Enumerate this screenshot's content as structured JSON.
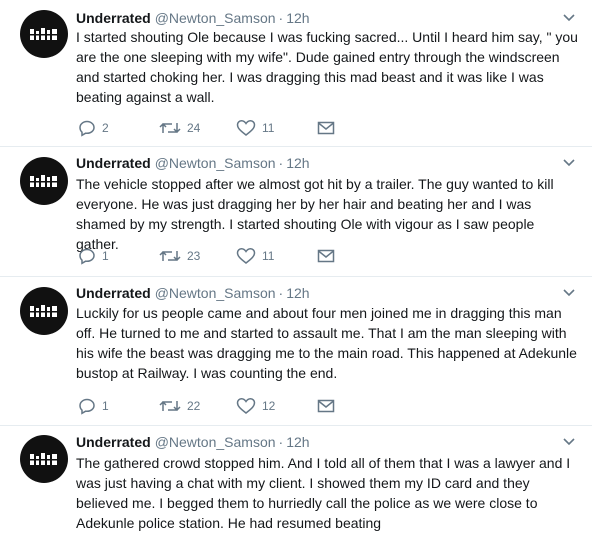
{
  "tweets": [
    {
      "name": "Underrated",
      "handle": "@Newton_Samson",
      "time": "12h",
      "text": "I started shouting Ole because I was fucking sacred... Until I heard him say, \" you are the one sleeping with my wife\". Dude gained entry through the windscreen and started choking her. I was dragging this mad beast and it was like I was beating against a wall.",
      "replies": "2",
      "retweets": "24",
      "likes": "11"
    },
    {
      "name": "Underrated",
      "handle": "@Newton_Samson",
      "time": "12h",
      "text": "The vehicle stopped after we almost got hit by a trailer. The guy wanted to kill everyone. He was just dragging her by her hair and beating her and I was shamed by my strength. I started shouting Ole with vigour as I saw people gather.",
      "replies": "1",
      "retweets": "23",
      "likes": "11"
    },
    {
      "name": "Underrated",
      "handle": "@Newton_Samson",
      "time": "12h",
      "text": "Luckily for us people came and about four men joined me in dragging this man off. He turned to me and started to assault me. That I am the man sleeping with his wife the beast was dragging me to the main road. This happened at Adekunle bustop at Railway. I was counting the end.",
      "replies": "1",
      "retweets": "22",
      "likes": "12"
    },
    {
      "name": "Underrated",
      "handle": "@Newton_Samson",
      "time": "12h",
      "text": "The gathered crowd stopped him. And I told all of them that I was a lawyer and I was just having a chat with my client. I showed them my ID card and they believed me. I begged them to hurriedly call the police as we were close to Adekunle police station. He had resumed beating",
      "replies": "",
      "retweets": "",
      "likes": ""
    }
  ],
  "icons": {
    "reply": "reply-icon",
    "retweet": "retweet-icon",
    "like": "heart-icon",
    "message": "envelope-icon",
    "more": "chevron-down-icon",
    "avatar": "avatar-logo"
  },
  "colors": {
    "icon_gray": "#657786",
    "divider": "#e6ecf0",
    "text": "#14171a"
  }
}
